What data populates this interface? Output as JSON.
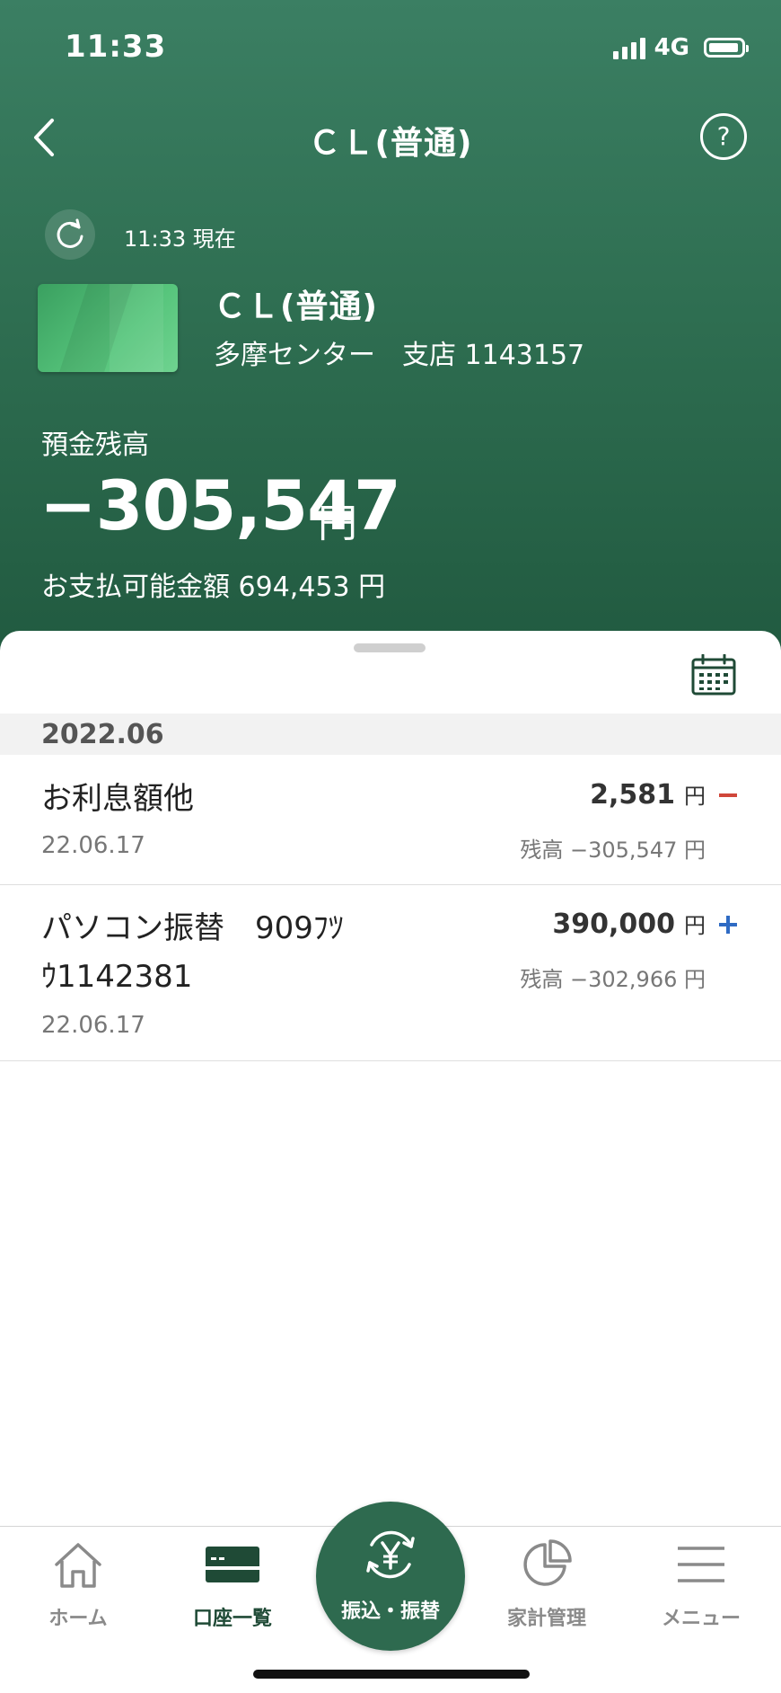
{
  "status_bar": {
    "time": "11:33",
    "network": "4G"
  },
  "header": {
    "title": "ＣＬ(普通)",
    "refresh_text": "11:33 現在",
    "account_name": "ＣＬ(普通)",
    "account_branch": "多摩センター　支店 1143157",
    "balance_label": "預金残高",
    "balance_value": "−305,547",
    "balance_unit": "円",
    "available_text": "お支払可能金額 694,453 円"
  },
  "month": "2022.06",
  "transactions": [
    {
      "description": "お利息額他",
      "date": "22.06.17",
      "amount": "2,581",
      "unit": "円",
      "balance": "残高 −305,547 円",
      "type": "minus"
    },
    {
      "description_line1": "パソコン振替　909ﾌﾂ",
      "description_line2": "ｳ1142381",
      "date": "22.06.17",
      "amount": "390,000",
      "unit": "円",
      "balance": "残高 −302,966 円",
      "type": "plus"
    }
  ],
  "tabbar": {
    "home": "ホーム",
    "accounts": "口座一覧",
    "transfer": "振込・振替",
    "budget": "家計管理",
    "menu": "メニュー"
  },
  "colors": {
    "header_green": "#2f6f52",
    "minus_red": "#d0473a",
    "plus_blue": "#2f6bc4",
    "active_tab": "#1f4a36"
  }
}
